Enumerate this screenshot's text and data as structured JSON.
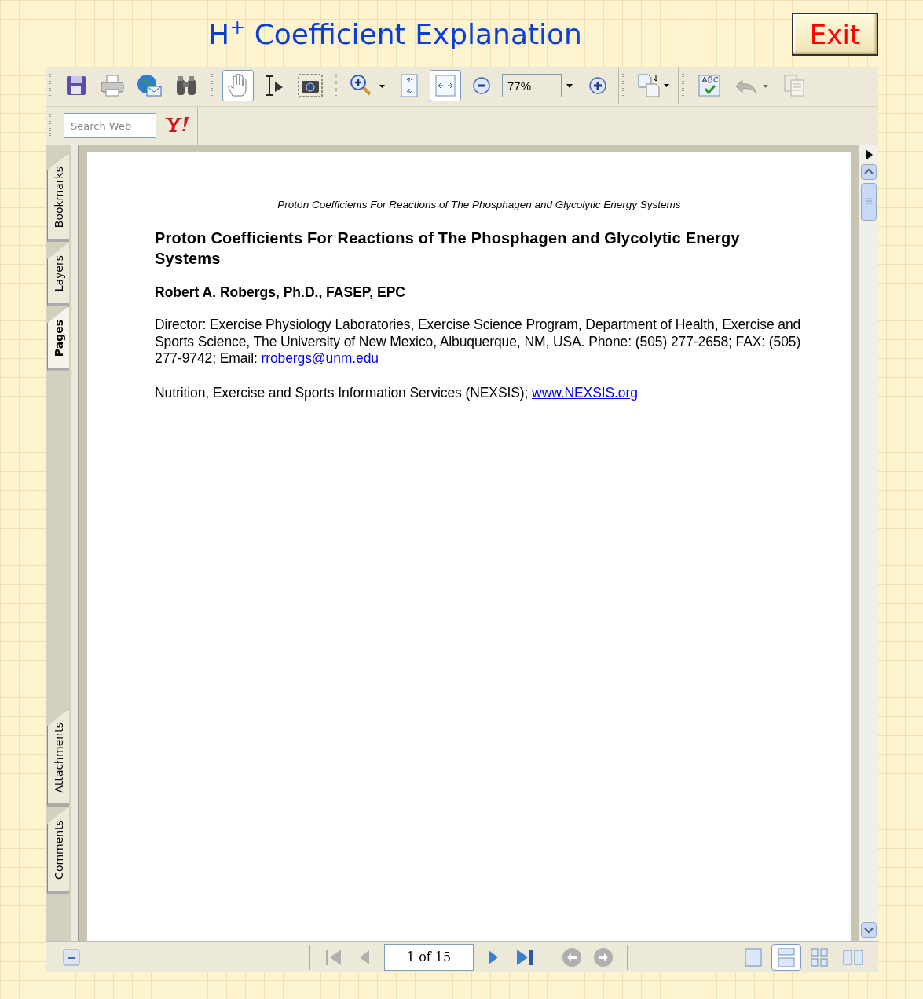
{
  "title": "H$^{+}$ Coefficient Explanation",
  "exit_button": "Exit",
  "toolbar": [
    [
      {
        "kind": "save",
        "selected": false,
        "disabled": false
      },
      {
        "kind": "print",
        "selected": false,
        "disabled": false
      },
      {
        "kind": "email",
        "selected": false,
        "disabled": false
      },
      {
        "kind": "find",
        "selected": false,
        "disabled": false
      }
    ],
    [
      {
        "kind": "hand",
        "selected": true,
        "disabled": false
      },
      {
        "kind": "select",
        "selected": false,
        "disabled": false
      },
      {
        "kind": "snapshot",
        "selected": false,
        "disabled": false
      }
    ],
    [
      {
        "kind": "zoom-in",
        "selected": false,
        "disabled": false
      },
      {
        "kind": "fit-page",
        "selected": false,
        "disabled": false
      },
      {
        "kind": "fit-width",
        "selected": true,
        "disabled": false
      },
      {
        "kind": "zoom-out",
        "selected": false,
        "disabled": false
      },
      {
        "kind": "zoom-field",
        "value": "77%"
      },
      {
        "kind": "zoom-plus",
        "selected": false,
        "disabled": false
      }
    ],
    [
      {
        "kind": "pages",
        "selected": false,
        "disabled": false
      }
    ],
    [
      {
        "kind": "spell",
        "disabled": false
      },
      {
        "kind": "undo",
        "disabled": true
      },
      {
        "kind": "copy",
        "disabled": true
      }
    ]
  ],
  "search": {
    "placeholder": "Search Web"
  },
  "side_tabs": [
    [
      {
        "label": "Bookmarks",
        "selected": false
      },
      {
        "label": "Layers",
        "selected": false
      },
      {
        "label": "Pages",
        "selected": true
      }
    ],
    [
      {
        "label": "Attachments",
        "selected": false
      },
      {
        "label": "Comments",
        "selected": false
      }
    ]
  ],
  "document": {
    "running_header": "Proton Coefficients For Reactions of The Phosphagen and Glycolytic Energy Systems",
    "heading": "Proton Coefficients For Reactions of The Phosphagen and Glycolytic Energy Systems",
    "author": "Robert A. Robergs, Ph.D., FASEP, EPC",
    "paragraphs": [
      {
        "text": "Director: Exercise Physiology Laboratories, Exercise Science Program, Department of Health, Exercise and Sports Science, The University of New Mexico, Albuquerque, NM, USA. Phone: (505) 277-2658; FAX: (505) 277-9742; Email: ",
        "link": "rrobergs@unm.edu"
      },
      {
        "text": "Nutrition, Exercise and Sports Information Services (NEXSIS); ",
        "link": "www.NEXSIS.org"
      }
    ]
  },
  "page_nav": {
    "page": "1 of 15",
    "buttons": [
      {
        "kind": "first",
        "disabled": true
      },
      {
        "kind": "prev",
        "disabled": true
      },
      {
        "kind": "field"
      },
      {
        "kind": "next",
        "disabled": false
      },
      {
        "kind": "last",
        "disabled": false
      },
      {
        "kind": "back",
        "disabled": true
      },
      {
        "kind": "forward",
        "disabled": true
      }
    ],
    "views": [
      {
        "kind": "single",
        "selected": false
      },
      {
        "kind": "continuous",
        "selected": true
      },
      {
        "kind": "grid",
        "selected": false
      },
      {
        "kind": "facing",
        "selected": false
      }
    ]
  }
}
